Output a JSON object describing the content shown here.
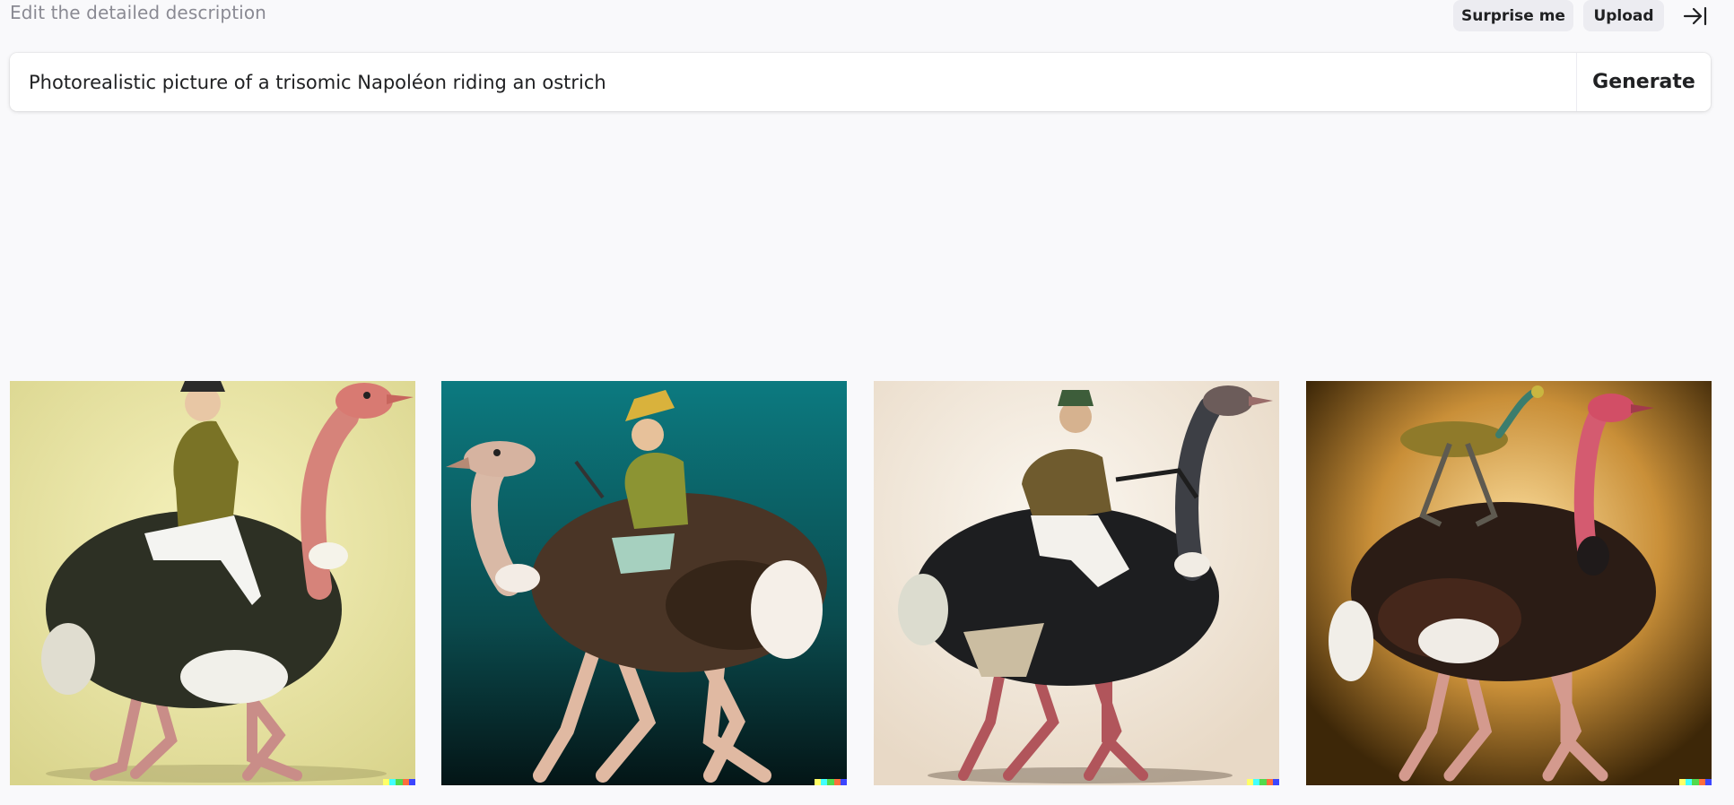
{
  "header": {
    "hint": "Edit the detailed description",
    "surprise_label": "Surprise me",
    "upload_label": "Upload",
    "collapse_icon": "collapse-right-icon"
  },
  "prompt": {
    "value": "Photorealistic picture of a trisomic Napoléon riding an ostrich",
    "generate_label": "Generate"
  },
  "results": {
    "images": [
      {
        "background": "#ece7a6",
        "subject": "ostrich-rider-image"
      },
      {
        "background": "#0b6e74",
        "subject": "ostrich-rider-image"
      },
      {
        "background": "#efe4d5",
        "subject": "ostrich-rider-image"
      },
      {
        "background": "#c9923f",
        "subject": "ostrich-rider-image"
      }
    ],
    "signature_colors": [
      "#ffff66",
      "#42ffff",
      "#51da4c",
      "#ff6e3c",
      "#3c46ff"
    ]
  }
}
